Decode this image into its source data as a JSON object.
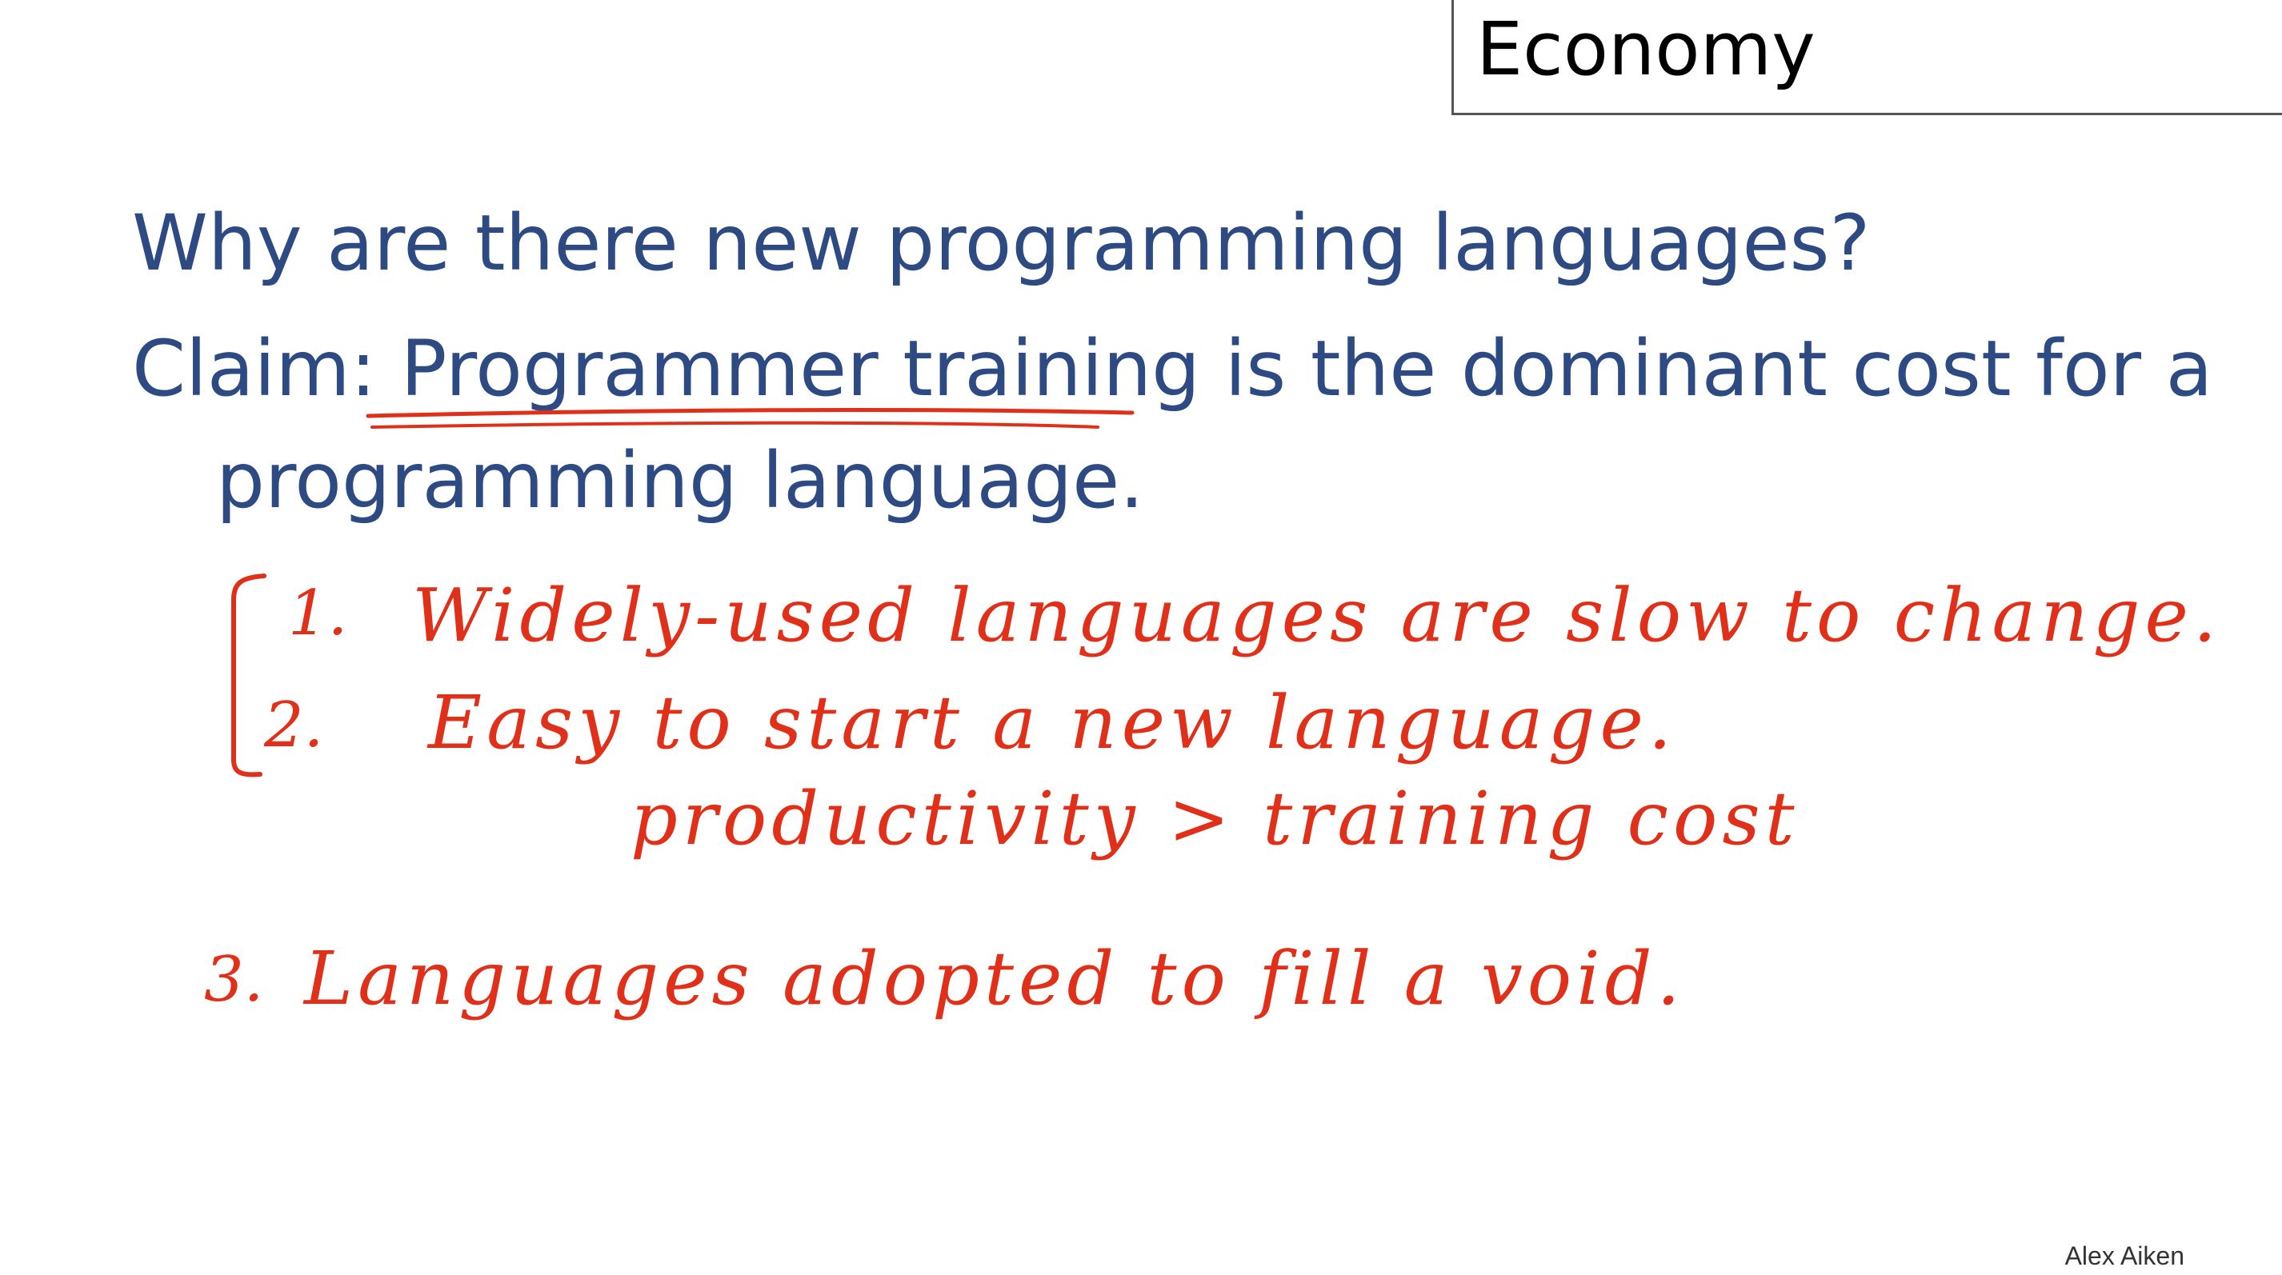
{
  "slide": {
    "title": "Economy",
    "question": "Why are there new programming languages?",
    "claim_prefix": "Claim: ",
    "claim_highlight": "Programmer training",
    "claim_rest": " is the dominant cost for a",
    "claim_cont": "programming language.",
    "author": "Alex Aiken"
  },
  "handwriting": {
    "item1_num": "1.",
    "item1_text": "Widely-used languages are slow to change.",
    "item2_num": "2.",
    "item2_text": "Easy to start a new language.",
    "item2_sub": "productivity > training cost",
    "item3_num": "3.",
    "item3_text": "Languages adopted to fill a void."
  },
  "colors": {
    "title_text": "#000000",
    "body_text": "#2e4a82",
    "ink": "#e0301a"
  }
}
